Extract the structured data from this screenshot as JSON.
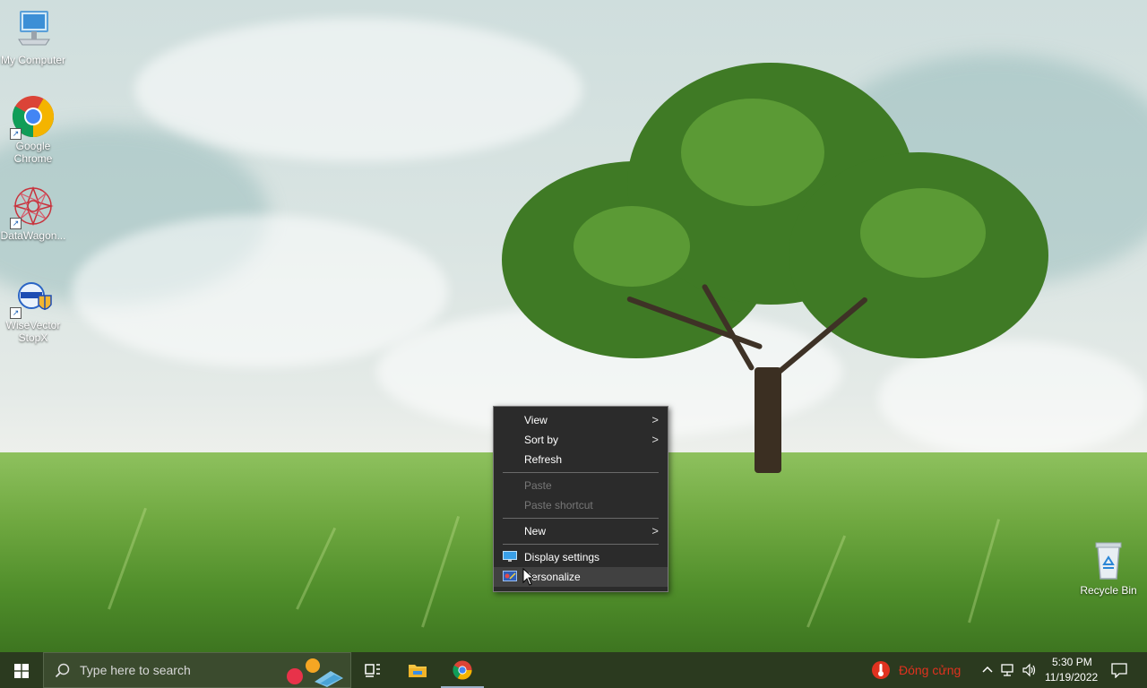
{
  "desktop": {
    "icons": [
      {
        "label": "My Computer"
      },
      {
        "label": "Google Chrome"
      },
      {
        "label": "DataWagon..."
      },
      {
        "label": "WiseVector StopX"
      }
    ],
    "recycle_bin": {
      "label": "Recycle Bin"
    }
  },
  "context_menu": {
    "items": [
      {
        "label": "View",
        "submenu": true,
        "enabled": true
      },
      {
        "label": "Sort by",
        "submenu": true,
        "enabled": true
      },
      {
        "label": "Refresh",
        "enabled": true
      },
      {
        "label": "Paste",
        "enabled": false
      },
      {
        "label": "Paste shortcut",
        "enabled": false
      },
      {
        "label": "New",
        "submenu": true,
        "enabled": true
      },
      {
        "label": "Display settings",
        "icon": "display-icon",
        "enabled": true
      },
      {
        "label": "Personalize",
        "icon": "personalize-icon",
        "enabled": true,
        "hovered": true
      }
    ]
  },
  "taskbar": {
    "search_placeholder": "Type here to search",
    "pinned": [
      "task-view-icon",
      "file-explorer-icon",
      "chrome-icon"
    ],
    "tray": {
      "temperature_label": "Đóng cửng",
      "time": "5:30 PM",
      "date": "11/19/2022"
    }
  },
  "colors": {
    "menu_bg": "#2b2b2b",
    "taskbar_bg": "#2b3a1f",
    "alert_red": "#e0321f"
  }
}
